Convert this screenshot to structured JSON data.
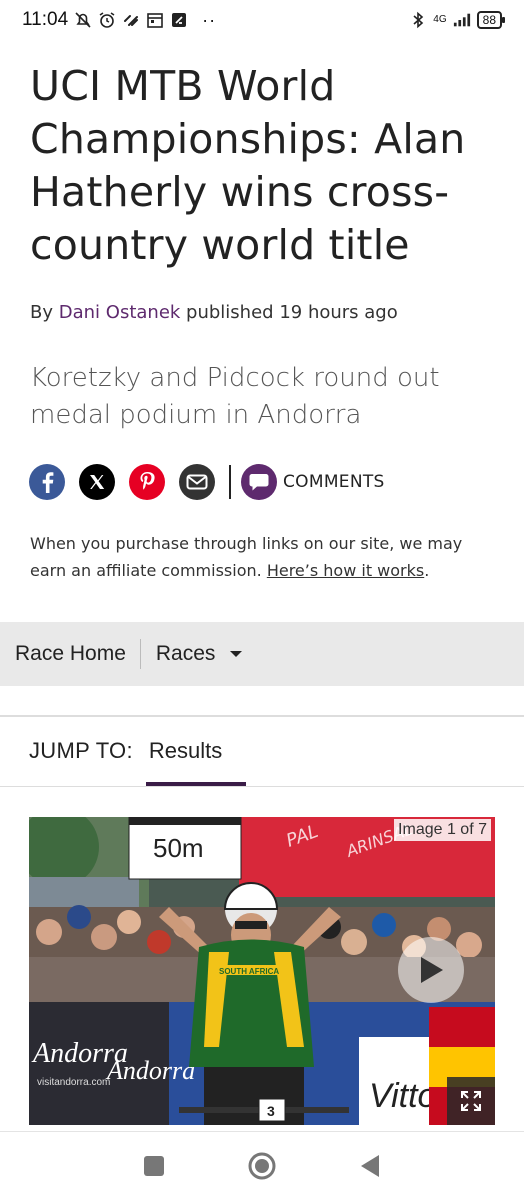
{
  "status_bar": {
    "time": "11:04",
    "network": "4G",
    "battery": "88",
    "icons": [
      "mute-icon",
      "alarm-icon",
      "link-icon",
      "calendar-icon",
      "app-icon",
      "bluetooth-icon",
      "signal-icon"
    ]
  },
  "article": {
    "headline": "UCI MTB World Championships: Alan Hatherly wins cross-country world title",
    "byline_prefix": "By",
    "author": "Dani Ostanek",
    "published": "published 19 hours ago",
    "standfirst": "Koretzky and Pidcock round out medal podium in Andorra"
  },
  "share": {
    "comments_label": "COMMENTS",
    "colors": {
      "facebook": "#3b5998",
      "x": "#000000",
      "pinterest": "#e60023",
      "email": "#333333",
      "comments": "#5e2a6e"
    }
  },
  "affiliate": {
    "text": "When you purchase through links on our site, we may earn an affiliate commission.",
    "link": "Here’s how it works",
    "suffix": "."
  },
  "race_nav": {
    "home_label": "Race Home",
    "races_label": "Races"
  },
  "jump_to": {
    "label": "JUMP TO:",
    "tab": "Results"
  },
  "hero": {
    "image_counter": "Image 1 of 7",
    "sign_text": "50m",
    "jersey_text": "SOUTH AFRICA",
    "bib_number": "3",
    "banner_text": "Andorra",
    "banner_sub": "visitandorra.com",
    "sponsor_text": "Vittoria"
  }
}
